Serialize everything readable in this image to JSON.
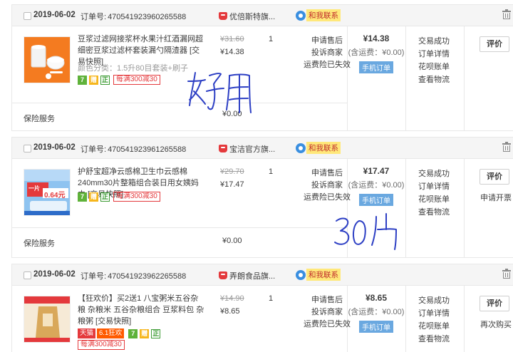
{
  "orders": [
    {
      "date": "2019-06-02",
      "order_label": "订单号:",
      "order_id": "470541923960265588",
      "shop": "优倍斯特旗...",
      "contact": "和我联系",
      "title": "豆浆过滤网接浆杯水果汁红酒漏网超细密豆浆过滤杯套装漏勺隔渣器 [交易快照]",
      "spec": "颜色分类：1.5升80目套装+刷子",
      "badges": {
        "seven": "7",
        "gift": "赠",
        "zheng": "正",
        "promo": "每满300减30"
      },
      "price_old": "¥31.60",
      "price_new": "¥14.38",
      "qty": "1",
      "after_sale": [
        "申请售后",
        "投诉商家",
        "运费险已失效"
      ],
      "total": "¥14.38",
      "shipping": "(含运费：¥0.00)",
      "mobile_order": "手机订单",
      "status": [
        "交易成功",
        "订单详情",
        "花呗账单",
        "查看物流"
      ],
      "eval_btn": "评价",
      "extra_action": "",
      "service_label": "保险服务",
      "service_price": "¥0.00"
    },
    {
      "date": "2019-06-02",
      "order_label": "订单号:",
      "order_id": "470541923961265588",
      "shop": "宝洁官方旗...",
      "contact": "和我联系",
      "title": "护舒宝超净云感棉卫生巾云感棉240mm30片整箱组合装日用女姨妈巾 [交易快照]",
      "spec": "",
      "badges": {
        "seven": "7",
        "gift": "赠",
        "zheng": "正",
        "promo": "每满300减30"
      },
      "price_old": "¥29.70",
      "price_new": "¥17.47",
      "qty": "1",
      "after_sale": [
        "申请售后",
        "投诉商家",
        "运费险已失效"
      ],
      "total": "¥17.47",
      "shipping": "(含运费：¥0.00)",
      "mobile_order": "手机订单",
      "status": [
        "交易成功",
        "订单详情",
        "花呗账单",
        "查看物流"
      ],
      "eval_btn": "评价",
      "extra_action": "申请开票",
      "service_label": "保险服务",
      "service_price": "¥0.00"
    },
    {
      "date": "2019-06-02",
      "order_label": "订单号:",
      "order_id": "470541923962265588",
      "shop": "弄朗食品旗...",
      "contact": "和我联系",
      "title": "【狂欢价】买2送1 八宝粥米五谷杂粮 杂粮米 五谷杂粮组合 豆浆料包 杂粮粥 [交易快照]",
      "spec": "",
      "badges": {
        "tmall": "天猫",
        "kuang": "6.1狂欢",
        "seven": "7",
        "gift": "赠",
        "zheng": "正",
        "promo": "每满300减30"
      },
      "price_old": "¥14.90",
      "price_new": "¥8.65",
      "qty": "1",
      "after_sale": [
        "申请售后",
        "投诉商家",
        "运费险已失效"
      ],
      "total": "¥8.65",
      "shipping": "(含运费：¥0.00)",
      "mobile_order": "手机订单",
      "status": [
        "交易成功",
        "订单详情",
        "花呗账单",
        "查看物流"
      ],
      "eval_btn": "评价",
      "extra_action": "再次购买"
    }
  ],
  "thumb_text": {
    "o2_a": "一片",
    "o2_b": "0.64元"
  },
  "colors": {
    "accent": "#e4393c",
    "header_bg": "#f5f5f5",
    "border": "#e8e8e8",
    "handwriting": "#2d3fc4"
  }
}
